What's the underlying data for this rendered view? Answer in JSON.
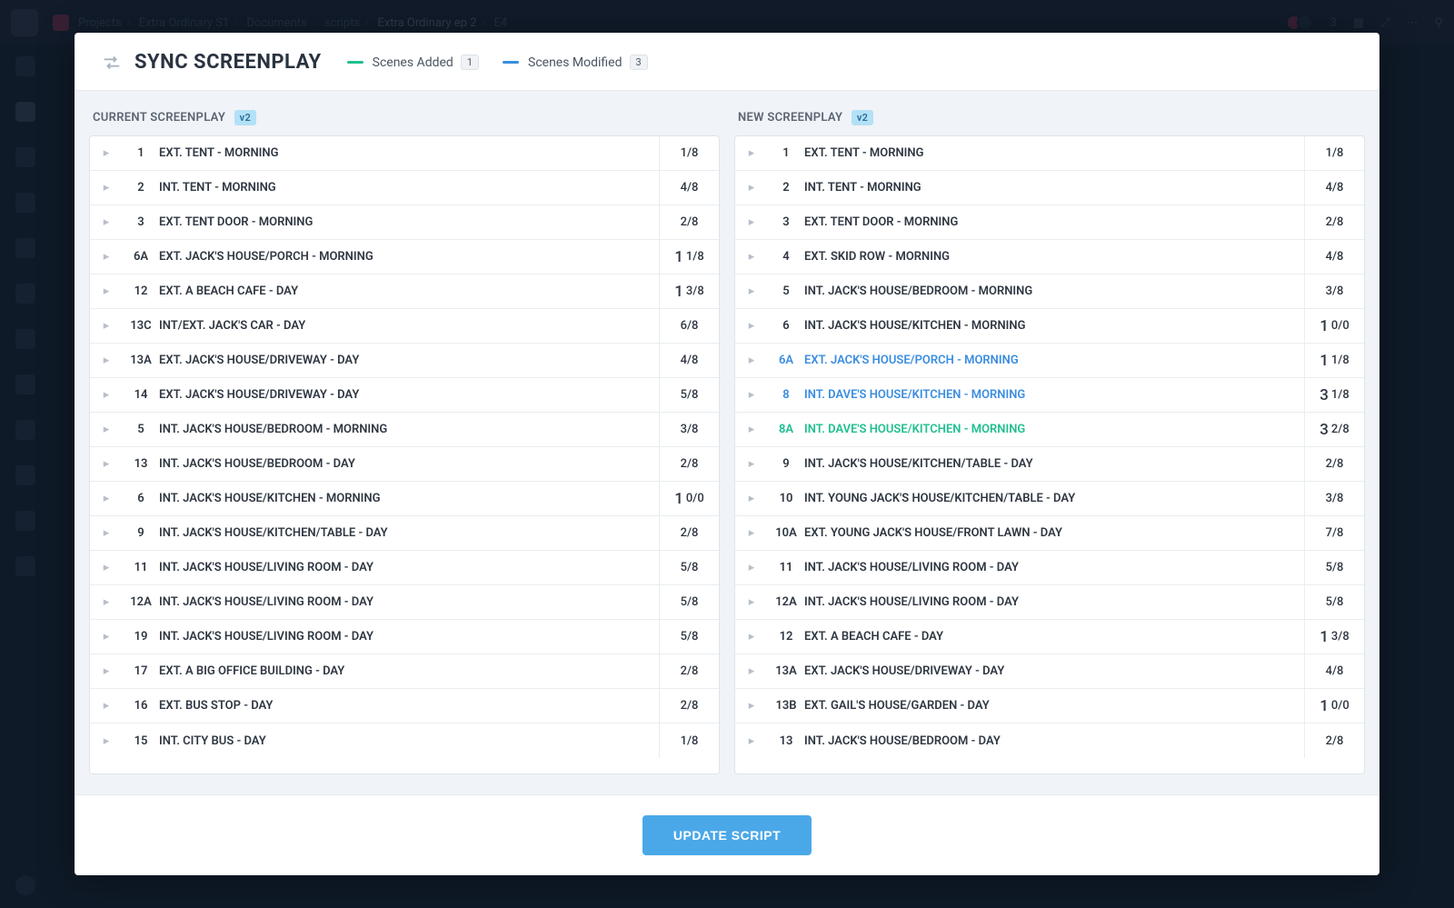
{
  "breadcrumbs": {
    "parts": [
      "Projects",
      "Extra Ordinary S1",
      "Documents",
      "scripts",
      "Extra Ordinary ep 2",
      "E4"
    ]
  },
  "topright": {
    "count": "3"
  },
  "modal": {
    "title": "SYNC SCREENPLAY",
    "legend_added": "Scenes Added",
    "legend_added_count": "1",
    "legend_modified": "Scenes Modified",
    "legend_modified_count": "3",
    "update_btn": "UPDATE SCRIPT"
  },
  "current": {
    "header": "CURRENT SCREENPLAY",
    "version": "v2",
    "scenes": [
      {
        "num": "1",
        "title": "EXT. TENT - MORNING",
        "len_big": "",
        "len": "1/8"
      },
      {
        "num": "2",
        "title": "INT. TENT - MORNING",
        "len_big": "",
        "len": "4/8"
      },
      {
        "num": "3",
        "title": "EXT. TENT DOOR - MORNING",
        "len_big": "",
        "len": "2/8"
      },
      {
        "num": "6A",
        "title": "EXT. JACK'S HOUSE/PORCH - MORNING",
        "len_big": "1",
        "len": "1/8"
      },
      {
        "num": "12",
        "title": "EXT. A BEACH CAFE - DAY",
        "len_big": "1",
        "len": "3/8"
      },
      {
        "num": "13C",
        "title": "INT/EXT. JACK'S CAR - DAY",
        "len_big": "",
        "len": "6/8"
      },
      {
        "num": "13A",
        "title": "EXT. JACK'S HOUSE/DRIVEWAY - DAY",
        "len_big": "",
        "len": "4/8"
      },
      {
        "num": "14",
        "title": "EXT. JACK'S HOUSE/DRIVEWAY - DAY",
        "len_big": "",
        "len": "5/8"
      },
      {
        "num": "5",
        "title": "INT. JACK'S HOUSE/BEDROOM - MORNING",
        "len_big": "",
        "len": "3/8"
      },
      {
        "num": "13",
        "title": "INT. JACK'S HOUSE/BEDROOM - DAY",
        "len_big": "",
        "len": "2/8"
      },
      {
        "num": "6",
        "title": "INT. JACK'S HOUSE/KITCHEN - MORNING",
        "len_big": "1",
        "len": "0/0"
      },
      {
        "num": "9",
        "title": "INT. JACK'S HOUSE/KITCHEN/TABLE - DAY",
        "len_big": "",
        "len": "2/8"
      },
      {
        "num": "11",
        "title": "INT. JACK'S HOUSE/LIVING ROOM - DAY",
        "len_big": "",
        "len": "5/8"
      },
      {
        "num": "12A",
        "title": "INT. JACK'S HOUSE/LIVING ROOM - DAY",
        "len_big": "",
        "len": "5/8"
      },
      {
        "num": "19",
        "title": "INT. JACK'S HOUSE/LIVING ROOM - DAY",
        "len_big": "",
        "len": "5/8"
      },
      {
        "num": "17",
        "title": "EXT. A BIG OFFICE BUILDING - DAY",
        "len_big": "",
        "len": "2/8"
      },
      {
        "num": "16",
        "title": "EXT. BUS STOP - DAY",
        "len_big": "",
        "len": "2/8"
      },
      {
        "num": "15",
        "title": "INT. CITY BUS - DAY",
        "len_big": "",
        "len": "1/8"
      }
    ]
  },
  "new": {
    "header": "NEW SCREENPLAY",
    "version": "v2",
    "scenes": [
      {
        "num": "1",
        "title": "EXT. TENT - MORNING",
        "len_big": "",
        "len": "1/8",
        "state": ""
      },
      {
        "num": "2",
        "title": "INT. TENT - MORNING",
        "len_big": "",
        "len": "4/8",
        "state": ""
      },
      {
        "num": "3",
        "title": "EXT. TENT DOOR - MORNING",
        "len_big": "",
        "len": "2/8",
        "state": ""
      },
      {
        "num": "4",
        "title": "EXT. SKID ROW - MORNING",
        "len_big": "",
        "len": "4/8",
        "state": ""
      },
      {
        "num": "5",
        "title": "INT. JACK'S HOUSE/BEDROOM - MORNING",
        "len_big": "",
        "len": "3/8",
        "state": ""
      },
      {
        "num": "6",
        "title": "INT. JACK'S HOUSE/KITCHEN - MORNING",
        "len_big": "1",
        "len": "0/0",
        "state": ""
      },
      {
        "num": "6A",
        "title": "EXT. JACK'S HOUSE/PORCH - MORNING",
        "len_big": "1",
        "len": "1/8",
        "state": "modified"
      },
      {
        "num": "8",
        "title": "INT. DAVE'S HOUSE/KITCHEN - MORNING",
        "len_big": "3",
        "len": "1/8",
        "state": "modified"
      },
      {
        "num": "8A",
        "title": "INT. DAVE'S HOUSE/KITCHEN - MORNING",
        "len_big": "3",
        "len": "2/8",
        "state": "added"
      },
      {
        "num": "9",
        "title": "INT. JACK'S HOUSE/KITCHEN/TABLE - DAY",
        "len_big": "",
        "len": "2/8",
        "state": ""
      },
      {
        "num": "10",
        "title": "INT. YOUNG JACK'S HOUSE/KITCHEN/TABLE - DAY",
        "len_big": "",
        "len": "3/8",
        "state": ""
      },
      {
        "num": "10A",
        "title": "EXT. YOUNG JACK'S HOUSE/FRONT LAWN - DAY",
        "len_big": "",
        "len": "7/8",
        "state": ""
      },
      {
        "num": "11",
        "title": "INT. JACK'S HOUSE/LIVING ROOM - DAY",
        "len_big": "",
        "len": "5/8",
        "state": ""
      },
      {
        "num": "12A",
        "title": "INT. JACK'S HOUSE/LIVING ROOM - DAY",
        "len_big": "",
        "len": "5/8",
        "state": ""
      },
      {
        "num": "12",
        "title": "EXT. A BEACH CAFE - DAY",
        "len_big": "1",
        "len": "3/8",
        "state": ""
      },
      {
        "num": "13A",
        "title": "EXT. JACK'S HOUSE/DRIVEWAY - DAY",
        "len_big": "",
        "len": "4/8",
        "state": ""
      },
      {
        "num": "13B",
        "title": "EXT. GAIL'S HOUSE/GARDEN - DAY",
        "len_big": "1",
        "len": "0/0",
        "state": ""
      },
      {
        "num": "13",
        "title": "INT. JACK'S HOUSE/BEDROOM - DAY",
        "len_big": "",
        "len": "2/8",
        "state": ""
      }
    ]
  }
}
